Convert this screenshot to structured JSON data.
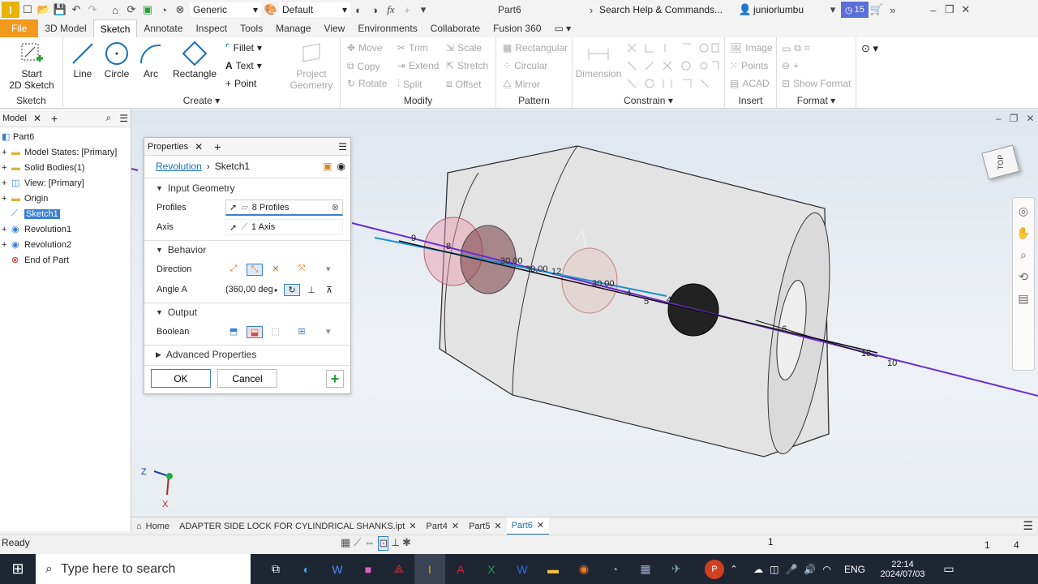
{
  "title_bar": {
    "material": "Generic",
    "appearance": "Default",
    "doc_title": "Part6",
    "search_placeholder": "Search Help & Commands...",
    "user": "juniorlumbu",
    "notif_count": "15"
  },
  "tabs": [
    "File",
    "3D Model",
    "Sketch",
    "Annotate",
    "Inspect",
    "Tools",
    "Manage",
    "View",
    "Environments",
    "Collaborate",
    "Fusion 360"
  ],
  "active_tab": "Sketch",
  "ribbon": {
    "sketch": {
      "start_line1": "Start",
      "start_line2": "2D Sketch",
      "label": "Sketch"
    },
    "create": {
      "line": "Line",
      "circle": "Circle",
      "arc": "Arc",
      "rectangle": "Rectangle",
      "fillet": "Fillet",
      "text": "Text",
      "point": "Point",
      "label": "Create"
    },
    "project": {
      "line1": "Project",
      "line2": "Geometry"
    },
    "modify": {
      "move": "Move",
      "trim": "Trim",
      "scale": "Scale",
      "copy": "Copy",
      "extend": "Extend",
      "stretch": "Stretch",
      "rotate": "Rotate",
      "split": "Split",
      "offset": "Offset",
      "label": "Modify"
    },
    "pattern": {
      "rectangular": "Rectangular",
      "circular": "Circular",
      "mirror": "Mirror",
      "label": "Pattern"
    },
    "constrain": {
      "dimension": "Dimension",
      "label": "Constrain"
    },
    "insert": {
      "image": "Image",
      "points": "Points",
      "acad": "ACAD",
      "label": "Insert"
    },
    "format": {
      "show_format": "Show Format",
      "label": "Format"
    }
  },
  "model_panel": {
    "title": "Model",
    "items": [
      {
        "label": "Part6",
        "level": 0
      },
      {
        "label": "Model States: [Primary]",
        "level": 1
      },
      {
        "label": "Solid Bodies(1)",
        "level": 1
      },
      {
        "label": "View: [Primary]",
        "level": 1
      },
      {
        "label": "Origin",
        "level": 1
      },
      {
        "label": "Sketch1",
        "level": 1
      },
      {
        "label": "Revolution1",
        "level": 1
      },
      {
        "label": "Revolution2",
        "level": 1
      },
      {
        "label": "End of Part",
        "level": 1
      }
    ]
  },
  "properties": {
    "title": "Properties",
    "crumb_feature": "Revolution",
    "crumb_sketch": "Sketch1",
    "input_geometry": "Input Geometry",
    "profiles_label": "Profiles",
    "profiles_value": "8 Profiles",
    "axis_label": "Axis",
    "axis_value": "1 Axis",
    "behavior": "Behavior",
    "direction_label": "Direction",
    "angle_label": "Angle A",
    "angle_value": "(360,00 deg",
    "output": "Output",
    "boolean_label": "Boolean",
    "advanced": "Advanced Properties",
    "ok": "OK",
    "cancel": "Cancel"
  },
  "viewport": {
    "dims": [
      "9",
      "8",
      "30,00",
      "30,00",
      "12",
      "30,00",
      "40",
      "15",
      "10",
      "5",
      "4",
      "5",
      "6"
    ],
    "viewcube_face": "TOP",
    "triad_z": "Z",
    "triad_x": "X"
  },
  "doc_tabs": [
    "Home",
    "ADAPTER SIDE LOCK FOR CYLINDRICAL SHANKS.ipt",
    "Part4",
    "Part5",
    "Part6"
  ],
  "active_doc": "Part6",
  "status": {
    "text": "Ready",
    "num1": "1",
    "num2": "1",
    "num3": "4"
  },
  "taskbar": {
    "search_placeholder": "Type here to search",
    "lang": "ENG",
    "time": "22:14",
    "date": "2024/07/03"
  }
}
